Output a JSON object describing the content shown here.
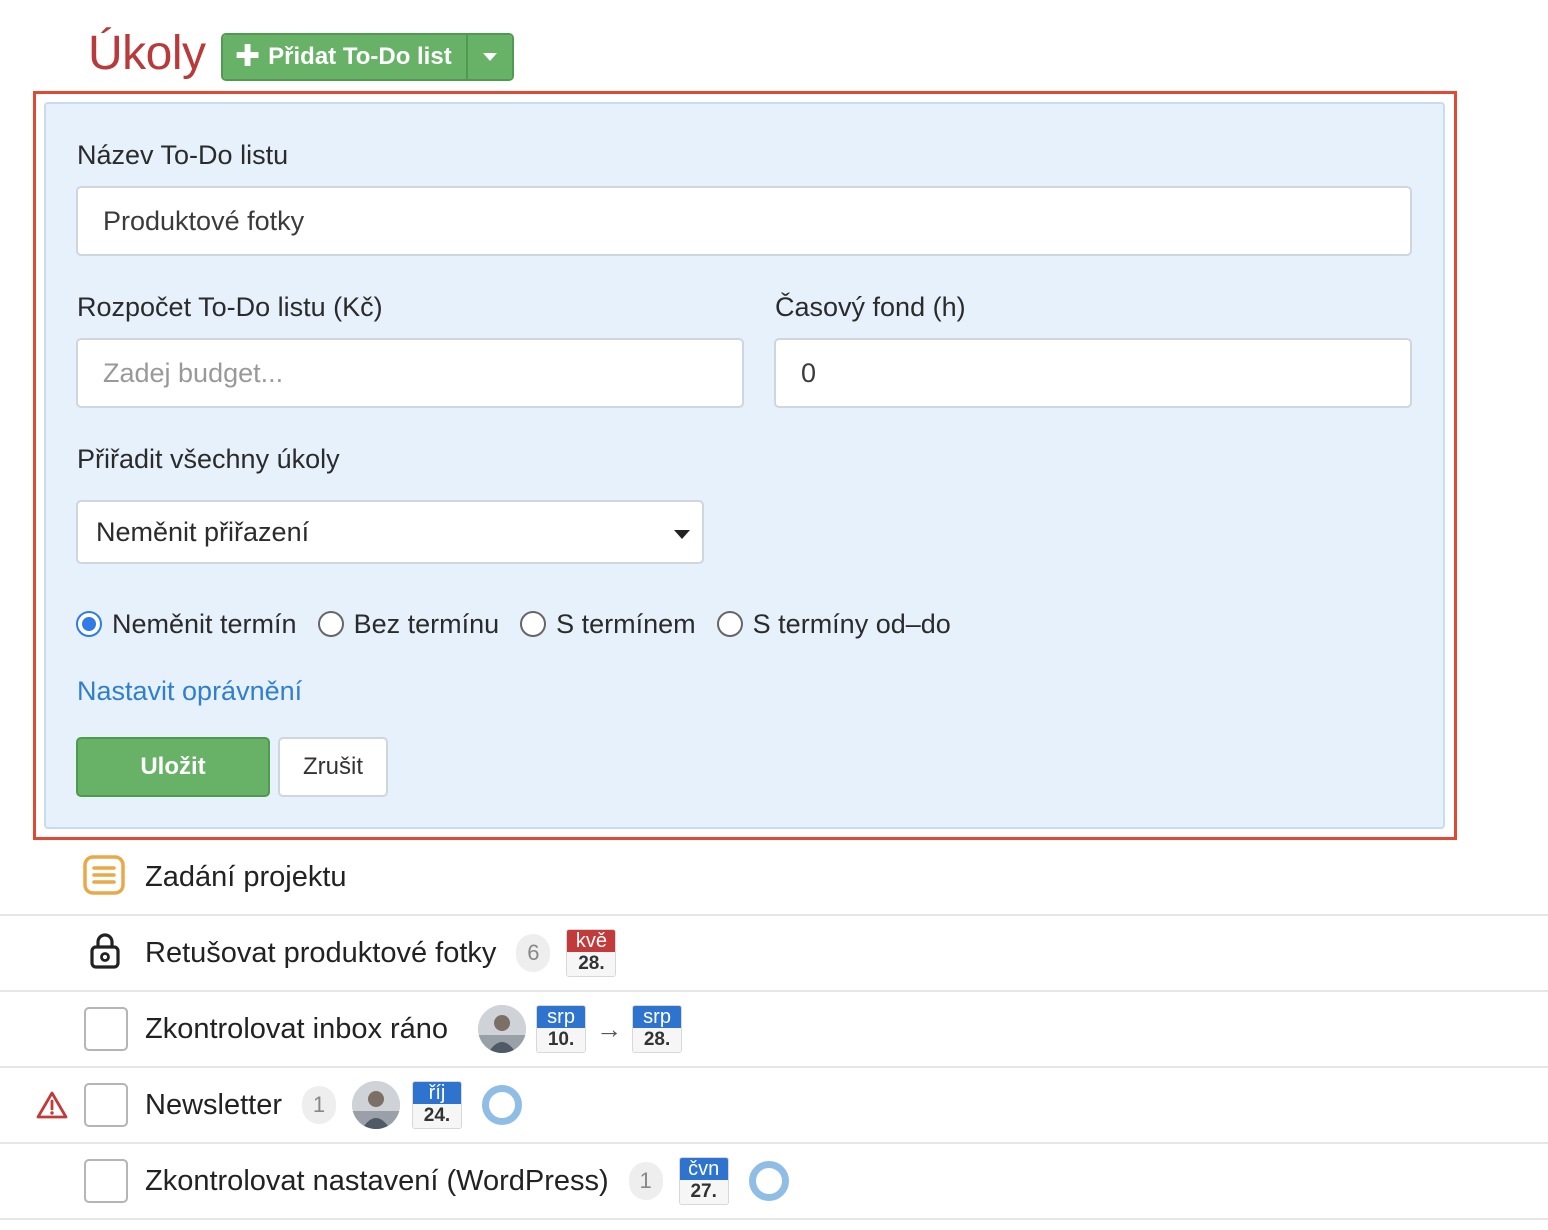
{
  "header": {
    "title": "Úkoly",
    "add_button_label": "Přidat To-Do list",
    "add_icon": "plus-icon",
    "dropdown_icon": "chevron-down-icon"
  },
  "form": {
    "name_label": "Název To-Do listu",
    "name_value": "Produktové fotky",
    "budget_label": "Rozpočet To-Do listu (Kč)",
    "budget_placeholder": "Zadej budget...",
    "time_label": "Časový fond (h)",
    "time_value": "0",
    "assign_label": "Přiřadit všechny úkoly",
    "assign_selected": "Neměnit přiřazení",
    "deadline_options": [
      {
        "label": "Neměnit termín",
        "checked": true
      },
      {
        "label": "Bez termínu",
        "checked": false
      },
      {
        "label": "S termínem",
        "checked": false
      },
      {
        "label": "S termíny od–do",
        "checked": false
      }
    ],
    "permissions_link": "Nastavit oprávnění",
    "save_label": "Uložit",
    "cancel_label": "Zrušit"
  },
  "tasks": [
    {
      "title": "Zadání projektu",
      "icon": "document-icon"
    },
    {
      "title": "Retušovat produktové fotky",
      "icon": "lock-icon",
      "count": "6",
      "date": {
        "month": "kvě",
        "day": "28."
      }
    },
    {
      "title": "Zkontrolovat inbox ráno",
      "date_from": {
        "month": "srp",
        "day": "10."
      },
      "date_to": {
        "month": "srp",
        "day": "28."
      }
    },
    {
      "title": "Newsletter",
      "warning": true,
      "count": "1",
      "date": {
        "month": "říj",
        "day": "24."
      }
    },
    {
      "title": "Zkontrolovat nastavení (WordPress)",
      "count": "1",
      "date": {
        "month": "čvn",
        "day": "27."
      }
    }
  ],
  "colors": {
    "title": "#b83a3a",
    "primary_green": "#67b267",
    "panel_bg": "#e7f1fb",
    "link_blue": "#2f7fcd",
    "highlight_red": "#e04a35",
    "date_blue": "#2e74cf",
    "date_red": "#c23a3a"
  }
}
